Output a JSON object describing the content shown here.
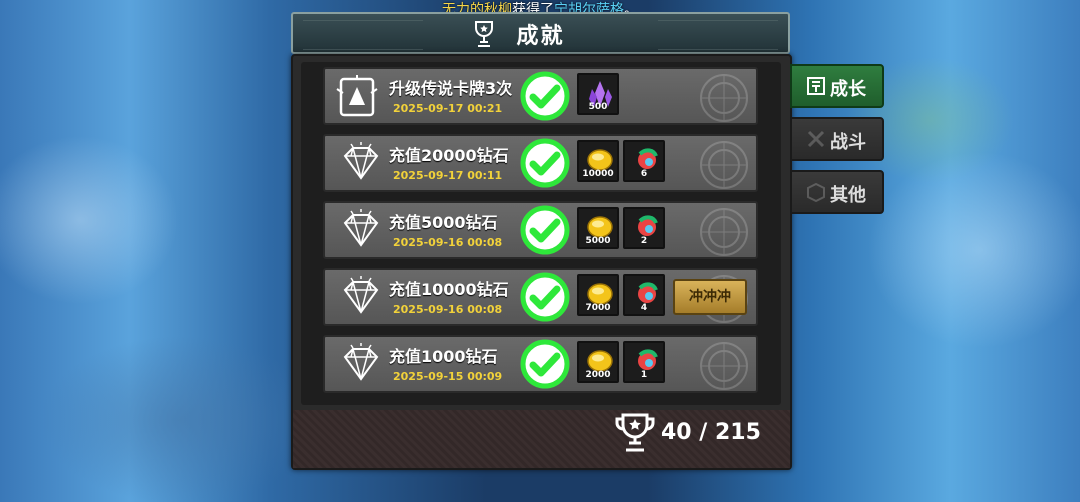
{
  "ticker": {
    "name1": "无力的秋柳",
    "mid": "获得了",
    "name2": "宁胡尔萨格",
    "end": "。"
  },
  "header": {
    "title": "成就"
  },
  "tabs": [
    {
      "label": "成长",
      "active": true
    },
    {
      "label": "战斗",
      "active": false
    },
    {
      "label": "其他",
      "active": false
    }
  ],
  "achievements": [
    {
      "name": "升级传说卡牌3次",
      "date": "2025-09-17 00:21",
      "icon": "card-icon",
      "rewards": [
        {
          "icon": "crystal-icon",
          "amount": "500"
        }
      ],
      "button": ""
    },
    {
      "name": "充值20000钻石",
      "date": "2025-09-17 00:11",
      "icon": "diamond-icon",
      "rewards": [
        {
          "icon": "gold-coin-icon",
          "amount": "10000"
        },
        {
          "icon": "potion-icon",
          "amount": "6"
        }
      ],
      "button": ""
    },
    {
      "name": "充值5000钻石",
      "date": "2025-09-16 00:08",
      "icon": "diamond-icon",
      "rewards": [
        {
          "icon": "gold-coin-icon",
          "amount": "5000"
        },
        {
          "icon": "potion-icon",
          "amount": "2"
        }
      ],
      "button": ""
    },
    {
      "name": "充值10000钻石",
      "date": "2025-09-16 00:08",
      "icon": "diamond-icon",
      "rewards": [
        {
          "icon": "gold-coin-icon",
          "amount": "7000"
        },
        {
          "icon": "potion-icon",
          "amount": "4"
        }
      ],
      "button": "冲冲冲"
    },
    {
      "name": "充值1000钻石",
      "date": "2025-09-15 00:09",
      "icon": "diamond-icon",
      "rewards": [
        {
          "icon": "gold-coin-icon",
          "amount": "2000"
        },
        {
          "icon": "potion-icon",
          "amount": "1"
        }
      ],
      "button": ""
    }
  ],
  "progress": {
    "text": "40 / 215",
    "completed": 40,
    "total": 215
  },
  "colors": {
    "check": "#2ee83a",
    "date": "#f2d23a",
    "active_tab": "#2f7d3f"
  }
}
